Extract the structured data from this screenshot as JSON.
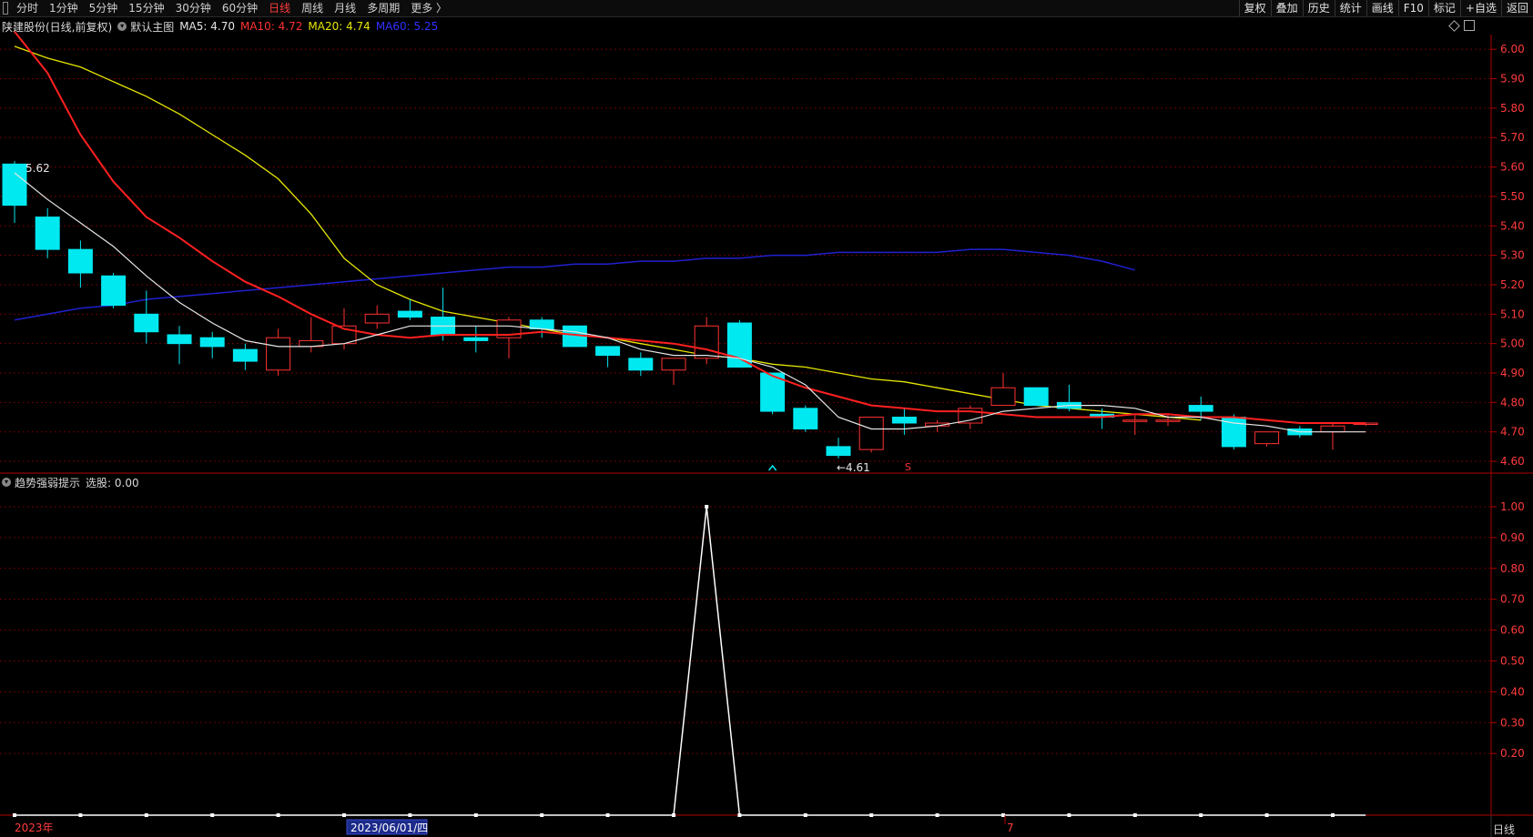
{
  "toolbar": {
    "left_items": [
      "分时",
      "1分钟",
      "5分钟",
      "15分钟",
      "30分钟",
      "60分钟",
      "日线",
      "周线",
      "月线",
      "多周期",
      "更多 〉"
    ],
    "active_item": "日线",
    "right_items": [
      "复权",
      "叠加",
      "历史",
      "统计",
      "画线",
      "F10",
      "标记",
      "+自选",
      "返回"
    ]
  },
  "main_legend": {
    "title": "陕建股份(日线,前复权)",
    "template": "默认主图",
    "ma5": "MA5: 4.70",
    "ma10": "MA10: 4.72",
    "ma20": "MA20: 4.74",
    "ma60": "MA60: 5.25"
  },
  "sub_legend": {
    "title": "趋势强弱提示",
    "value": "选股: 0.00"
  },
  "x_axis": {
    "year_label": "2023年",
    "crosshair_date": "2023/06/01/四",
    "month_label": "7"
  },
  "period_label": "日线",
  "colors": {
    "up": "#ff3232",
    "down": "#00e8f0",
    "ma5": "#e6e6e6",
    "ma10": "#ff2020",
    "ma20": "#e6e600",
    "ma60": "#2020d0",
    "grid": "#6a0000",
    "axis": "#b00000",
    "axis_text": "#ff3b3b",
    "indicator": "#ffffff"
  },
  "chart_data": [
    {
      "type": "candlestick",
      "title": "陕建股份(日线,前复权)",
      "ylim": [
        4.56,
        6.05
      ],
      "y_ticks": [
        "6.00",
        "5.90",
        "5.80",
        "5.70",
        "5.60",
        "5.50",
        "5.40",
        "5.30",
        "5.20",
        "5.10",
        "5.00",
        "4.90",
        "4.80",
        "4.70",
        "4.60"
      ],
      "candles": [
        {
          "o": 5.61,
          "h": 5.62,
          "l": 5.41,
          "c": 5.47
        },
        {
          "o": 5.43,
          "h": 5.46,
          "l": 5.29,
          "c": 5.32
        },
        {
          "o": 5.32,
          "h": 5.35,
          "l": 5.19,
          "c": 5.24
        },
        {
          "o": 5.23,
          "h": 5.24,
          "l": 5.12,
          "c": 5.13
        },
        {
          "o": 5.1,
          "h": 5.18,
          "l": 5.0,
          "c": 5.04
        },
        {
          "o": 5.03,
          "h": 5.06,
          "l": 4.93,
          "c": 5.0
        },
        {
          "o": 5.02,
          "h": 5.04,
          "l": 4.95,
          "c": 4.99
        },
        {
          "o": 4.98,
          "h": 5.0,
          "l": 4.91,
          "c": 4.94
        },
        {
          "o": 4.91,
          "h": 5.05,
          "l": 4.89,
          "c": 5.02
        },
        {
          "o": 4.99,
          "h": 5.09,
          "l": 4.97,
          "c": 5.01
        },
        {
          "o": 5.0,
          "h": 5.12,
          "l": 4.98,
          "c": 5.06
        },
        {
          "o": 5.07,
          "h": 5.13,
          "l": 5.05,
          "c": 5.1
        },
        {
          "o": 5.11,
          "h": 5.15,
          "l": 5.08,
          "c": 5.09
        },
        {
          "o": 5.09,
          "h": 5.19,
          "l": 5.01,
          "c": 5.03
        },
        {
          "o": 5.02,
          "h": 5.06,
          "l": 4.97,
          "c": 5.01
        },
        {
          "o": 5.02,
          "h": 5.09,
          "l": 4.95,
          "c": 5.08
        },
        {
          "o": 5.08,
          "h": 5.09,
          "l": 5.02,
          "c": 5.05
        },
        {
          "o": 5.06,
          "h": 5.06,
          "l": 4.99,
          "c": 4.99
        },
        {
          "o": 4.99,
          "h": 4.99,
          "l": 4.92,
          "c": 4.96
        },
        {
          "o": 4.95,
          "h": 4.97,
          "l": 4.89,
          "c": 4.91
        },
        {
          "o": 4.91,
          "h": 4.95,
          "l": 4.86,
          "c": 4.95
        },
        {
          "o": 4.95,
          "h": 5.09,
          "l": 4.93,
          "c": 5.06
        },
        {
          "o": 5.07,
          "h": 5.08,
          "l": 4.93,
          "c": 4.92
        },
        {
          "o": 4.9,
          "h": 4.9,
          "l": 4.76,
          "c": 4.77
        },
        {
          "o": 4.78,
          "h": 4.79,
          "l": 4.7,
          "c": 4.71
        },
        {
          "o": 4.65,
          "h": 4.68,
          "l": 4.61,
          "c": 4.62
        },
        {
          "o": 4.64,
          "h": 4.75,
          "l": 4.63,
          "c": 4.75
        },
        {
          "o": 4.75,
          "h": 4.78,
          "l": 4.69,
          "c": 4.73
        },
        {
          "o": 4.72,
          "h": 4.74,
          "l": 4.7,
          "c": 4.73
        },
        {
          "o": 4.73,
          "h": 4.79,
          "l": 4.71,
          "c": 4.78
        },
        {
          "o": 4.79,
          "h": 4.9,
          "l": 4.79,
          "c": 4.85
        },
        {
          "o": 4.85,
          "h": 4.85,
          "l": 4.79,
          "c": 4.79
        },
        {
          "o": 4.8,
          "h": 4.86,
          "l": 4.77,
          "c": 4.78
        },
        {
          "o": 4.76,
          "h": 4.78,
          "l": 4.71,
          "c": 4.75
        },
        {
          "o": 4.74,
          "h": 4.76,
          "l": 4.69,
          "c": 4.74
        },
        {
          "o": 4.74,
          "h": 4.76,
          "l": 4.72,
          "c": 4.74
        },
        {
          "o": 4.79,
          "h": 4.82,
          "l": 4.74,
          "c": 4.77
        },
        {
          "o": 4.75,
          "h": 4.76,
          "l": 4.64,
          "c": 4.65
        },
        {
          "o": 4.66,
          "h": 4.7,
          "l": 4.65,
          "c": 4.7
        },
        {
          "o": 4.71,
          "h": 4.72,
          "l": 4.68,
          "c": 4.69
        },
        {
          "o": 4.7,
          "h": 4.73,
          "l": 4.64,
          "c": 4.72
        },
        {
          "o": 4.73,
          "h": 4.73,
          "l": 4.72,
          "c": 4.73
        }
      ],
      "ma5": [
        5.58,
        5.49,
        5.41,
        5.33,
        5.23,
        5.14,
        5.07,
        5.01,
        4.99,
        4.99,
        5.0,
        5.03,
        5.06,
        5.06,
        5.06,
        5.06,
        5.05,
        5.04,
        5.02,
        4.98,
        4.96,
        4.96,
        4.95,
        4.92,
        4.86,
        4.75,
        4.71,
        4.71,
        4.72,
        4.74,
        4.77,
        4.78,
        4.79,
        4.79,
        4.78,
        4.75,
        4.75,
        4.73,
        4.72,
        4.7,
        4.7,
        4.7
      ],
      "ma10": [
        6.06,
        5.92,
        5.71,
        5.55,
        5.43,
        5.36,
        5.28,
        5.21,
        5.16,
        5.1,
        5.05,
        5.03,
        5.02,
        5.03,
        5.03,
        5.03,
        5.04,
        5.03,
        5.02,
        5.01,
        5.0,
        4.98,
        4.95,
        4.89,
        4.85,
        4.82,
        4.79,
        4.78,
        4.77,
        4.77,
        4.76,
        4.75,
        4.75,
        4.75,
        4.76,
        4.76,
        4.75,
        4.75,
        4.74,
        4.73,
        4.73,
        4.73
      ],
      "ma20": [
        6.01,
        5.97,
        5.94,
        5.89,
        5.84,
        5.78,
        5.71,
        5.64,
        5.56,
        5.44,
        5.29,
        5.2,
        5.15,
        5.11,
        5.09,
        5.07,
        5.05,
        5.03,
        5.02,
        5.0,
        4.98,
        4.96,
        4.95,
        4.93,
        4.92,
        4.9,
        4.88,
        4.87,
        4.85,
        4.83,
        4.81,
        4.79,
        4.78,
        4.77,
        4.76,
        4.75,
        4.74
      ],
      "ma20_start": 0,
      "ma60": [
        5.08,
        5.1,
        5.12,
        5.13,
        5.15,
        5.16,
        5.17,
        5.18,
        5.19,
        5.2,
        5.21,
        5.22,
        5.23,
        5.24,
        5.25,
        5.26,
        5.26,
        5.27,
        5.27,
        5.28,
        5.28,
        5.29,
        5.29,
        5.3,
        5.3,
        5.31,
        5.31,
        5.31,
        5.31,
        5.32,
        5.32,
        5.31,
        5.3,
        5.28,
        5.25
      ],
      "annotations": [
        {
          "label": "5.62",
          "index": 0,
          "price": 5.62
        },
        {
          "label": "←4.61",
          "index": 25,
          "price": 4.61
        }
      ]
    },
    {
      "type": "line",
      "title": "趋势强弱提示",
      "ylim": [
        0,
        1.05
      ],
      "y_ticks": [
        "1.00",
        "0.90",
        "0.80",
        "0.70",
        "0.60",
        "0.50",
        "0.40",
        "0.30",
        "0.20"
      ],
      "values": [
        0,
        0,
        0,
        0,
        0,
        0,
        0,
        0,
        0,
        0,
        0,
        0,
        0,
        0,
        0,
        0,
        0,
        0,
        0,
        0,
        0,
        1,
        0,
        0,
        0,
        0,
        0,
        0,
        0,
        0,
        0,
        0,
        0,
        0,
        0,
        0,
        0,
        0,
        0,
        0,
        0,
        0
      ],
      "peak_index": 31
    }
  ]
}
